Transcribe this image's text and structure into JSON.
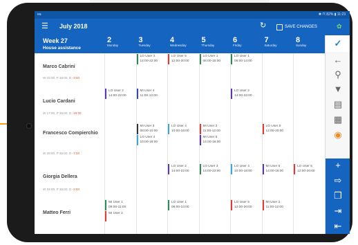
{
  "status": {
    "left": "ea",
    "right": "✱ ☈ 82% ▮ 11:23"
  },
  "appbar": {
    "title": "July 2018",
    "save_label": "SAVE CHANGES"
  },
  "header": {
    "week": "Week 27",
    "group": "House assistance"
  },
  "days": [
    {
      "num": "2",
      "weekday": "Monday"
    },
    {
      "num": "3",
      "weekday": "Tuesday"
    },
    {
      "num": "4",
      "weekday": "Wednesday"
    },
    {
      "num": "5",
      "weekday": "Thursday"
    },
    {
      "num": "6",
      "weekday": "Friday"
    },
    {
      "num": "7",
      "weekday": "Saturday"
    },
    {
      "num": "8",
      "weekday": "Sunday"
    }
  ],
  "rows": [
    {
      "name": "Marco Cabrini",
      "hours": "W 33:00, P 36:00, D ",
      "diff": "-3:00"
    },
    {
      "name": "Lucio Cardani",
      "hours": "W 17:00, P 36:00, D ",
      "diff": "-19:00"
    },
    {
      "name": "Francesco Compierchio",
      "hours": "W 29:00, P 36:00, D ",
      "diff": "-7:00"
    },
    {
      "name": "Giorgia Dellera",
      "hours": "W 34:00, P 36:00, D ",
      "diff": "-2:00"
    },
    {
      "name": "Matteo Ferri",
      "hours": "",
      "diff": ""
    }
  ],
  "shifts": [
    {
      "row": 0,
      "day": 1,
      "sub": 0,
      "user": "LO User 3",
      "time": "14:00-22:00",
      "color": "#2e8b57"
    },
    {
      "row": 0,
      "day": 2,
      "sub": 0,
      "user": "LO User 5",
      "time": "12:00-20:00",
      "color": "#e53935"
    },
    {
      "row": 0,
      "day": 3,
      "sub": 0,
      "user": "LO User 1",
      "time": "06:00-15:00",
      "color": "#2e8b57"
    },
    {
      "row": 0,
      "day": 4,
      "sub": 0,
      "user": "LO User 1",
      "time": "06:00-14:00",
      "color": "#2e8b57"
    },
    {
      "row": 1,
      "day": 0,
      "sub": 0,
      "user": "LO User 2",
      "time": "14:00-22:00",
      "color": "#5e35b1"
    },
    {
      "row": 1,
      "day": 1,
      "sub": 0,
      "user": "MI User 4",
      "time": "11:00-12:00",
      "color": "#3949ab"
    },
    {
      "row": 1,
      "day": 4,
      "sub": 0,
      "user": "LO User 2",
      "time": "14:00-22:00",
      "color": "#5e35b1"
    },
    {
      "row": 2,
      "day": 1,
      "sub": 0,
      "user": "MI User 3",
      "time": "08:00-10:00",
      "color": "#333333"
    },
    {
      "row": 2,
      "day": 1,
      "sub": 1,
      "user": "LO User 4",
      "time": "10:00-18:00",
      "color": "#3aa6dd"
    },
    {
      "row": 2,
      "day": 2,
      "sub": 0,
      "user": "LO User 4",
      "time": "10:00-18:00",
      "color": "#3aa6dd"
    },
    {
      "row": 2,
      "day": 3,
      "sub": 0,
      "user": "MI User 2",
      "time": "11:00-12:00",
      "color": "#e53935"
    },
    {
      "row": 2,
      "day": 3,
      "sub": 1,
      "user": "MI User 5",
      "time": "14:00-16:00",
      "color": "#5e35b1"
    },
    {
      "row": 2,
      "day": 5,
      "sub": 0,
      "user": "LO User 5",
      "time": "12:00-20:00",
      "color": "#e53935"
    },
    {
      "row": 3,
      "day": 2,
      "sub": 0,
      "user": "LO User 2",
      "time": "14:00-22:00",
      "color": "#5e35b1"
    },
    {
      "row": 3,
      "day": 3,
      "sub": 0,
      "user": "LO User 3",
      "time": "14:00-22:00",
      "color": "#2e8b57"
    },
    {
      "row": 3,
      "day": 4,
      "sub": 0,
      "user": "LO User 4",
      "time": "10:00-18:00",
      "color": "#3aa6dd"
    },
    {
      "row": 3,
      "day": 5,
      "sub": 0,
      "user": "MI User 5",
      "time": "14:00-16:00",
      "color": "#5e35b1"
    },
    {
      "row": 3,
      "day": 6,
      "sub": 0,
      "user": "LO User 5",
      "time": "12:00-20:00",
      "color": "#e53935"
    },
    {
      "row": 4,
      "day": 0,
      "sub": 0,
      "user": "MI User 1",
      "time": "09:00-11:00",
      "color": "#2e8b57"
    },
    {
      "row": 4,
      "day": 0,
      "sub": 1,
      "user": "MI User 2",
      "time": "",
      "color": "#e53935"
    },
    {
      "row": 4,
      "day": 2,
      "sub": 0,
      "user": "LO User 1",
      "time": "06:00-14:00",
      "color": "#2e8b57"
    },
    {
      "row": 4,
      "day": 4,
      "sub": 0,
      "user": "LO User 5",
      "time": "12:00-20:00",
      "color": "#e53935"
    },
    {
      "row": 4,
      "day": 5,
      "sub": 0,
      "user": "MI User 2",
      "time": "11:00-12:00",
      "color": "#e53935"
    }
  ],
  "sidebar": {
    "icons": [
      "checkmark-icon",
      "arrow-left-icon",
      "search-icon",
      "filter-icon",
      "calendar-icon",
      "list-calendar-icon",
      "eye-icon",
      "add-icon",
      "login-icon",
      "copy-icon",
      "import-icon",
      "export-icon"
    ]
  },
  "colors": {
    "primary": "#1565c0",
    "negative": "#e05a1c",
    "orange_accent": "#f0a020"
  }
}
